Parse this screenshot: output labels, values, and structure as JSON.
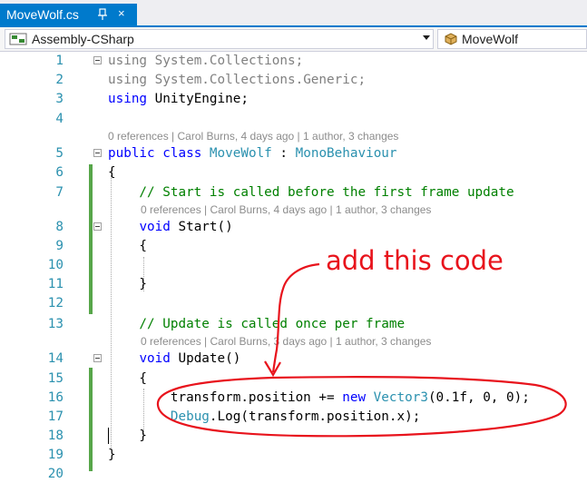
{
  "tab": {
    "title": "MoveWolf.cs",
    "close": "×"
  },
  "nav": {
    "project": "Assembly-CSharp",
    "class": "MoveWolf"
  },
  "annotation": "add this code",
  "colors": {
    "accent": "#007acc",
    "change_bar": "#57a64a",
    "annotation": "#e8131c"
  },
  "lines": [
    {
      "n": "1",
      "parts": [
        {
          "t": "using",
          "c": "gr"
        },
        {
          "t": " System.Collections;",
          "c": "gr"
        }
      ]
    },
    {
      "n": "2",
      "parts": [
        {
          "t": "using",
          "c": "gr"
        },
        {
          "t": " System.Collections.Generic;",
          "c": "gr"
        }
      ]
    },
    {
      "n": "3",
      "parts": [
        {
          "t": "using",
          "c": "kw"
        },
        {
          "t": " UnityEngine;",
          "c": ""
        }
      ]
    },
    {
      "n": "4",
      "parts": []
    },
    {
      "n": "5",
      "parts": [
        {
          "t": "public",
          "c": "kw"
        },
        {
          "t": " ",
          "c": ""
        },
        {
          "t": "class",
          "c": "kw"
        },
        {
          "t": " ",
          "c": ""
        },
        {
          "t": "MoveWolf",
          "c": "ty"
        },
        {
          "t": " : ",
          "c": ""
        },
        {
          "t": "MonoBehaviour",
          "c": "ty"
        }
      ]
    },
    {
      "n": "6",
      "parts": [
        {
          "t": "{",
          "c": ""
        }
      ]
    },
    {
      "n": "7",
      "parts": [
        {
          "t": "    // Start is called before the first frame update",
          "c": "cm"
        }
      ]
    },
    {
      "n": "8",
      "parts": [
        {
          "t": "    ",
          "c": ""
        },
        {
          "t": "void",
          "c": "kw"
        },
        {
          "t": " Start()",
          "c": ""
        }
      ]
    },
    {
      "n": "9",
      "parts": [
        {
          "t": "    {",
          "c": ""
        }
      ]
    },
    {
      "n": "10",
      "parts": []
    },
    {
      "n": "11",
      "parts": [
        {
          "t": "    }",
          "c": ""
        }
      ]
    },
    {
      "n": "12",
      "parts": []
    },
    {
      "n": "13",
      "parts": [
        {
          "t": "    // Update is called once per frame",
          "c": "cm"
        }
      ]
    },
    {
      "n": "14",
      "parts": [
        {
          "t": "    ",
          "c": ""
        },
        {
          "t": "void",
          "c": "kw"
        },
        {
          "t": " Update()",
          "c": ""
        }
      ]
    },
    {
      "n": "15",
      "parts": [
        {
          "t": "    {",
          "c": ""
        }
      ]
    },
    {
      "n": "16",
      "parts": [
        {
          "t": "        transform.position += ",
          "c": ""
        },
        {
          "t": "new",
          "c": "kw"
        },
        {
          "t": " ",
          "c": ""
        },
        {
          "t": "Vector3",
          "c": "ty"
        },
        {
          "t": "(0.1f, 0, 0);",
          "c": ""
        }
      ]
    },
    {
      "n": "17",
      "parts": [
        {
          "t": "        ",
          "c": ""
        },
        {
          "t": "Debug",
          "c": "ty"
        },
        {
          "t": ".Log(transform.position.x);",
          "c": ""
        }
      ]
    },
    {
      "n": "18",
      "parts": [
        {
          "t": "    }",
          "c": ""
        }
      ]
    },
    {
      "n": "19",
      "parts": [
        {
          "t": "}",
          "c": ""
        }
      ]
    },
    {
      "n": "20",
      "parts": []
    }
  ],
  "lens": [
    {
      "text": "0 references | Carol Burns, 4 days ago | 1 author, 3 changes"
    },
    {
      "text": "0 references | Carol Burns, 4 days ago | 1 author, 3 changes"
    },
    {
      "text": "0 references | Carol Burns, 3 days ago | 1 author, 3 changes"
    }
  ]
}
